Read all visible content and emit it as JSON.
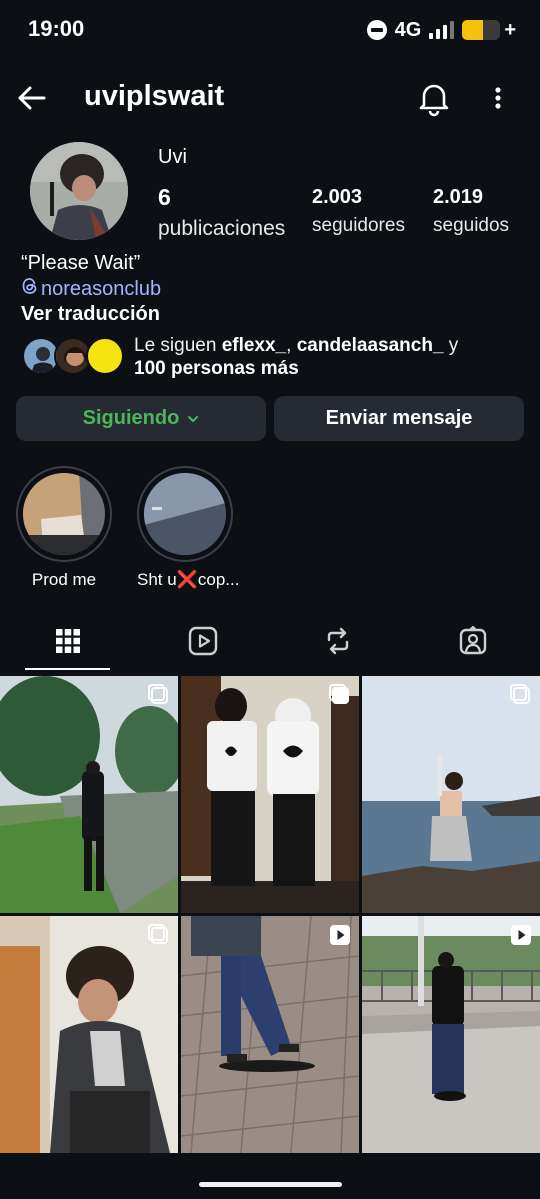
{
  "status_bar": {
    "time": "19:00",
    "network": "4G",
    "battery_level": 0.55,
    "icons": [
      "do-not-disturb-icon",
      "signal-icon",
      "battery-icon",
      "charging-icon"
    ]
  },
  "header": {
    "username": "uviplswait",
    "icons": [
      "back-arrow-icon",
      "bell-icon",
      "more-vertical-icon"
    ]
  },
  "profile": {
    "display_name": "Uvi",
    "stats": [
      {
        "value": "6",
        "label": "publicaciones"
      },
      {
        "value": "2.003",
        "label": "seguidores"
      },
      {
        "value": "2.019",
        "label": "seguidos"
      }
    ],
    "bio": "“Please Wait”",
    "link": "noreasonclub",
    "translate": "Ver traducción",
    "followed_by_prefix": "Le siguen ",
    "followed_by_1": "eflexx_",
    "followed_by_sep": ", ",
    "followed_by_2": "candelaasanch_",
    "followed_by_and": " y",
    "followed_by_more": "100 personas más"
  },
  "actions": {
    "follow_label": "Siguiendo",
    "message_label": "Enviar mensaje"
  },
  "highlights": [
    {
      "label": "Prod me"
    },
    {
      "label": "Sht u❌cop..."
    }
  ],
  "tabs": [
    "grid-icon",
    "reels-icon",
    "reposts-icon",
    "tagged-icon"
  ],
  "posts": [
    {
      "type": "carousel"
    },
    {
      "type": "carousel"
    },
    {
      "type": "carousel"
    },
    {
      "type": "carousel"
    },
    {
      "type": "reel"
    },
    {
      "type": "reel"
    }
  ],
  "colors": {
    "background": "#0c0f14",
    "button": "#262a33",
    "following_green": "#4cb65c",
    "link": "#a5b4ff",
    "battery": "#f4c20d"
  }
}
